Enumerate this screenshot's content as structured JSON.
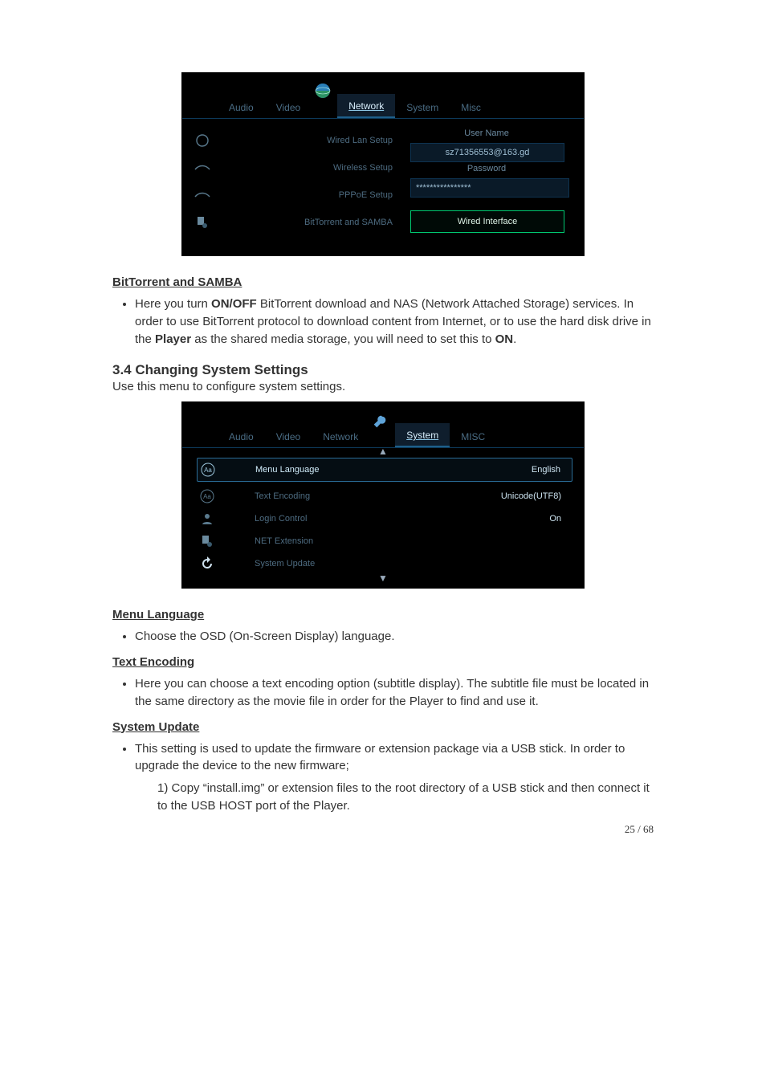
{
  "screenshot1": {
    "tabs": {
      "audio": "Audio",
      "video": "Video",
      "network": "Network",
      "system": "System",
      "misc": "Misc"
    },
    "menu": {
      "wiredLan": "Wired Lan Setup",
      "wireless": "Wireless Setup",
      "pppoe": "PPPoE Setup",
      "btSamba": "BitTorrent and SAMBA"
    },
    "right": {
      "userNameLabel": "User Name",
      "userName": "sz71356553@163.gd",
      "passwordLabel": "Password",
      "passwordMasked": "****************",
      "button": "Wired Interface"
    }
  },
  "sec_bt_head": "BitTorrent and SAMBA",
  "sec_bt_body_pre": "Here you turn ",
  "sec_bt_onoff": "ON/OFF",
  "sec_bt_body_mid": " BitTorrent download and NAS (Network Attached Storage) services. In order to use BitTorrent protocol to download content from Internet, or to use the hard disk drive in the ",
  "sec_bt_player": "Player",
  "sec_bt_body_post": " as the shared media storage, you will need to set this to ",
  "sec_bt_on": "ON",
  "sec_bt_period": ".",
  "h34": "3.4 Changing System Settings",
  "h34_sub": "Use this menu to configure system settings.",
  "screenshot2": {
    "tabs": {
      "audio": "Audio",
      "video": "Video",
      "network": "Network",
      "system": "System",
      "misc": "MISC"
    },
    "menu": {
      "menuLanguage": "Menu Language",
      "textEncoding": "Text Encoding",
      "loginControl": "Login Control",
      "netExtension": "NET Extension",
      "systemUpdate": "System Update"
    },
    "values": {
      "menuLanguage": "English",
      "textEncoding": "Unicode(UTF8)",
      "loginControl": "On"
    }
  },
  "sec_ml_head": "Menu Language",
  "sec_ml_body": "Choose the OSD (On-Screen Display) language.",
  "sec_te_head": "Text Encoding",
  "sec_te_body": "Here you can choose a text encoding option (subtitle display). The subtitle file must be located in the same directory as the movie file in order for the Player to find and use it.",
  "sec_su_head": "System Update",
  "sec_su_body": "This setting is used to update the firmware or extension package via a USB stick. In order to upgrade the device to the new firmware;",
  "sec_su_step1": "Copy “install.img” or extension files to the root directory of a USB stick and then connect it to the USB HOST port of the Player.",
  "page_number": "25 / 68"
}
